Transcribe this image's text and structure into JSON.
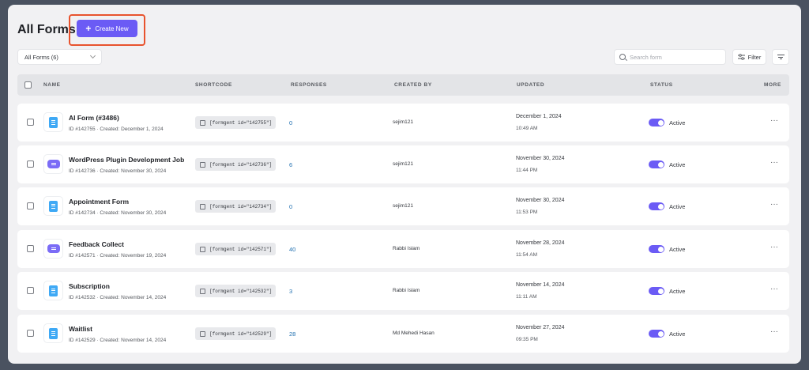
{
  "header": {
    "title": "All Forms",
    "create_label": "Create New"
  },
  "toolbar": {
    "filter_select_value": "All Forms (6)",
    "search_placeholder": "Search form",
    "filter_label": "Filter"
  },
  "table": {
    "columns": [
      "NAME",
      "SHORTCODE",
      "RESPONSES",
      "CREATED BY",
      "UPDATED",
      "STATUS",
      "MORE"
    ],
    "rows": [
      {
        "name": "AI Form (#3486)",
        "meta": "ID #142755 · Created: December 1, 2024",
        "icon": "document-icon",
        "shortcode": "[formgent id=\"142755\"]",
        "responses": "0",
        "author": "sejim121",
        "updated_date": "December 1, 2024",
        "updated_time": "10:49 AM",
        "status": "Active"
      },
      {
        "name": "WordPress Plugin Development Job",
        "meta": "ID #142736 · Created: November 30, 2024",
        "icon": "chat-icon",
        "shortcode": "[formgent id=\"142736\"]",
        "responses": "6",
        "author": "sejim121",
        "updated_date": "November 30, 2024",
        "updated_time": "11:44 PM",
        "status": "Active"
      },
      {
        "name": "Appointment Form",
        "meta": "ID #142734 · Created: November 30, 2024",
        "icon": "document-icon",
        "shortcode": "[formgent id=\"142734\"]",
        "responses": "0",
        "author": "sejim121",
        "updated_date": "November 30, 2024",
        "updated_time": "11:53 PM",
        "status": "Active"
      },
      {
        "name": "Feedback Collect",
        "meta": "ID #142571 · Created: November 19, 2024",
        "icon": "chat-icon",
        "shortcode": "[formgent id=\"142571\"]",
        "responses": "40",
        "author": "Rabbi Islam",
        "updated_date": "November 28, 2024",
        "updated_time": "11:54 AM",
        "status": "Active"
      },
      {
        "name": "Subscription",
        "meta": "ID #142532 · Created: November 14, 2024",
        "icon": "document-icon",
        "shortcode": "[formgent id=\"142532\"]",
        "responses": "3",
        "author": "Rabbi Islam",
        "updated_date": "November 14, 2024",
        "updated_time": "11:11 AM",
        "status": "Active"
      },
      {
        "name": "Waitlist",
        "meta": "ID #142529 · Created: November 14, 2024",
        "icon": "document-icon",
        "shortcode": "[formgent id=\"142529\"]",
        "responses": "28",
        "author": "Md Mehedi Hasan",
        "updated_date": "November 27, 2024",
        "updated_time": "09:35 PM",
        "status": "Active"
      }
    ]
  },
  "colors": {
    "accent": "#6b5bf5",
    "highlight": "#e8532e",
    "link": "#2271b1"
  }
}
